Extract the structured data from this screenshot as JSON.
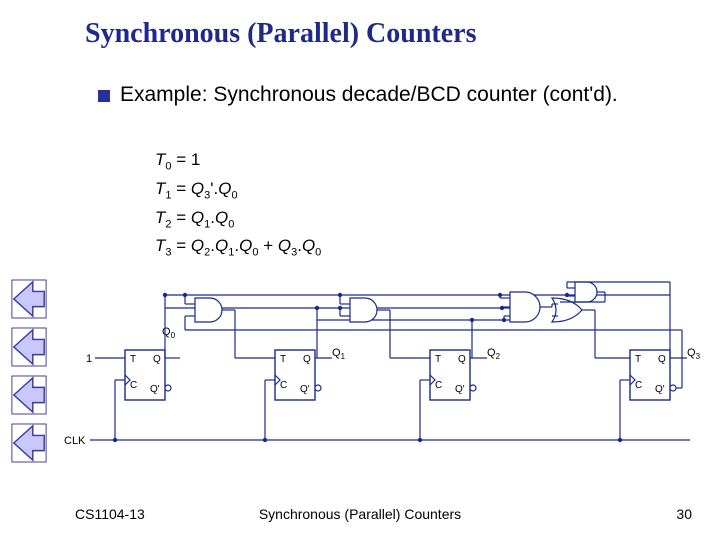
{
  "title": "Synchronous (Parallel) Counters",
  "bullet": "Example: Synchronous decade/BCD counter (cont'd).",
  "equations": {
    "t0": "T₀ = 1",
    "t1": "T₁ = Q₃'.Q₀",
    "t2": "T₂ = Q₁.Q₀",
    "t3": "T₃ = Q₂.Q₁.Q₀ + Q₃.Q₀"
  },
  "circuit": {
    "input_label": "1",
    "clk_label": "CLK",
    "ff_ports": {
      "T": "T",
      "C": "C",
      "Q": "Q",
      "Qn": "Q'"
    },
    "outputs": [
      "Q₀",
      "Q₁",
      "Q₂",
      "Q₃"
    ]
  },
  "footer": {
    "left": "CS1104-13",
    "center": "Synchronous (Parallel) Counters",
    "right": "30"
  }
}
